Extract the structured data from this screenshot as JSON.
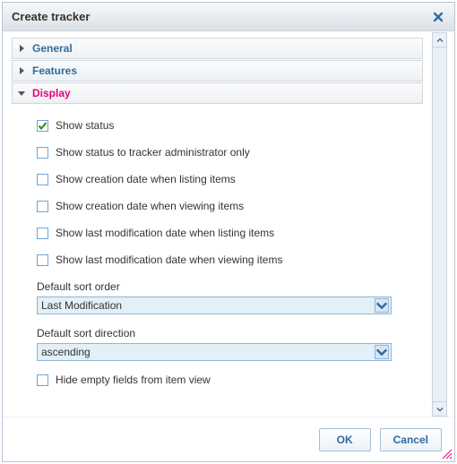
{
  "dialog": {
    "title": "Create tracker"
  },
  "accordion": {
    "general": {
      "label": "General"
    },
    "features": {
      "label": "Features"
    },
    "display": {
      "label": "Display"
    }
  },
  "display": {
    "checks": [
      {
        "label": "Show status",
        "checked": true
      },
      {
        "label": "Show status to tracker administrator only",
        "checked": false
      },
      {
        "label": "Show creation date when listing items",
        "checked": false
      },
      {
        "label": "Show creation date when viewing items",
        "checked": false
      },
      {
        "label": "Show last modification date when listing items",
        "checked": false
      },
      {
        "label": "Show last modification date when viewing items",
        "checked": false
      }
    ],
    "sort_order_label": "Default sort order",
    "sort_order_value": "Last Modification",
    "sort_direction_label": "Default sort direction",
    "sort_direction_value": "ascending",
    "hide_empty": {
      "label": "Hide empty fields from item view",
      "checked": false
    }
  },
  "buttons": {
    "ok": "OK",
    "cancel": "Cancel"
  }
}
